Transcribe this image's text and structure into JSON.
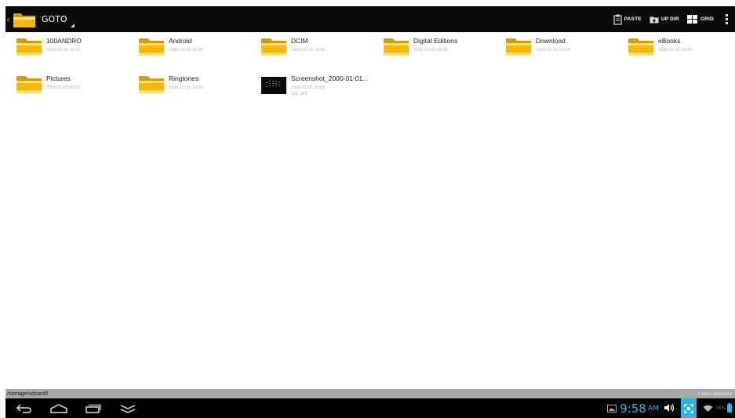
{
  "actionbar": {
    "title": "GOTO",
    "actions": [
      {
        "label": "PASTE",
        "icon": "clipboard-icon"
      },
      {
        "label": "UP DIR",
        "icon": "up-folder-icon"
      },
      {
        "label": "GRID",
        "icon": "grid-icon"
      }
    ]
  },
  "files": [
    {
      "name": "100ANDRO",
      "meta": "1999-12-31 19:41",
      "type": "folder"
    },
    {
      "name": "Android",
      "meta": "1999-12-31 19:38",
      "type": "folder"
    },
    {
      "name": "DCIM",
      "meta": "1999-12-31 19:41",
      "type": "folder"
    },
    {
      "name": "Digital Editions",
      "meta": "1999-12-31 19:43",
      "type": "folder"
    },
    {
      "name": "Download",
      "meta": "1999-12-31 19:34",
      "type": "folder"
    },
    {
      "name": "eBooks",
      "meta": "1999-12-31 19:43",
      "type": "folder"
    },
    {
      "name": "Pictures",
      "meta": "2000-01-01 09:52",
      "type": "folder"
    },
    {
      "name": "Ringtones",
      "meta": "1999-12-31 19:38",
      "type": "folder"
    },
    {
      "name": "Screenshot_2000-01-01...",
      "meta": "2000-01-01 09:58",
      "size": "221.1KB",
      "type": "image"
    }
  ],
  "statusbar": {
    "path": "/storage/sdcard0",
    "selection": "0 item selected"
  },
  "system": {
    "time": "9:58",
    "ampm": "AM",
    "battery": "76%"
  },
  "colors": {
    "accent": "#2fb3e6",
    "folder": "#f5b800",
    "actionbar": "#0b0b0b"
  }
}
